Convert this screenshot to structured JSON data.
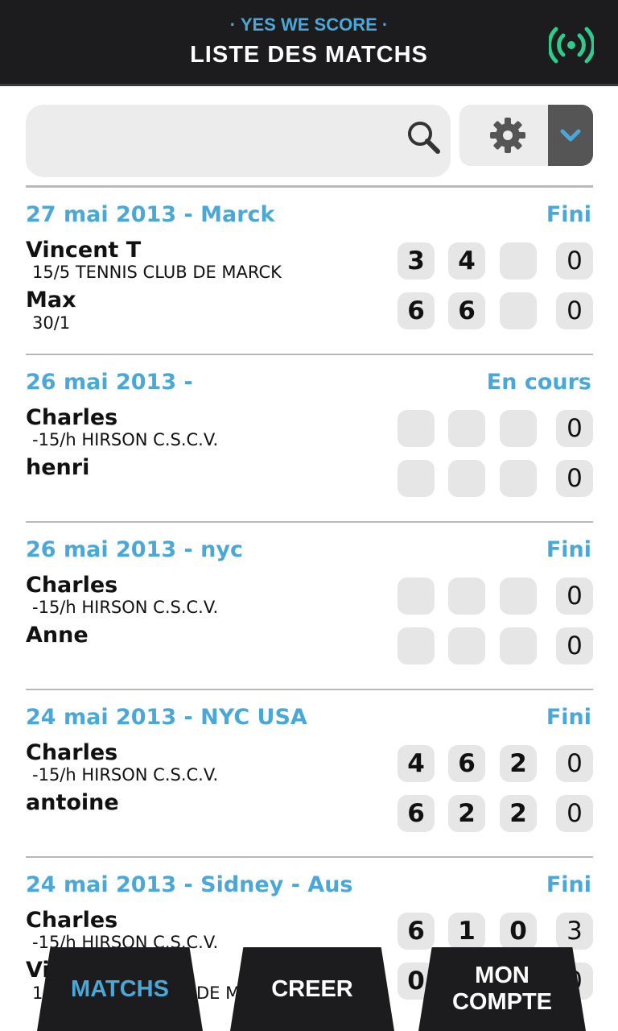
{
  "header": {
    "brand": "· YES WE SCORE ·",
    "title": "LISTE DES MATCHS"
  },
  "search": {
    "placeholder": ""
  },
  "colors": {
    "accent": "#4aa8d8",
    "dark": "#1c1c1e",
    "signal": "#2ecc8a"
  },
  "matches": [
    {
      "head": "27 mai 2013 - Marck",
      "status": "Fini",
      "p1": {
        "name": "Vincent T",
        "sub": "15/5 TENNIS CLUB DE MARCK",
        "s1": "3",
        "s2": "4",
        "s3": "",
        "pts": "0"
      },
      "p2": {
        "name": "Max",
        "sub": "30/1",
        "s1": "6",
        "s2": "6",
        "s3": "",
        "pts": "0"
      }
    },
    {
      "head": "26 mai 2013 -",
      "status": "En cours",
      "p1": {
        "name": "Charles",
        "sub": "-15/h HIRSON C.S.C.V.",
        "s1": "",
        "s2": "",
        "s3": "",
        "pts": "0"
      },
      "p2": {
        "name": "henri",
        "sub": "",
        "s1": "",
        "s2": "",
        "s3": "",
        "pts": "0"
      }
    },
    {
      "head": "26 mai 2013 - nyc",
      "status": "Fini",
      "p1": {
        "name": "Charles",
        "sub": "-15/h HIRSON C.S.C.V.",
        "s1": "",
        "s2": "",
        "s3": "",
        "pts": "0"
      },
      "p2": {
        "name": "Anne",
        "sub": "",
        "s1": "",
        "s2": "",
        "s3": "",
        "pts": "0"
      }
    },
    {
      "head": "24 mai 2013 - NYC USA",
      "status": "Fini",
      "p1": {
        "name": "Charles",
        "sub": "-15/h HIRSON C.S.C.V.",
        "s1": "4",
        "s2": "6",
        "s3": "2",
        "pts": "0"
      },
      "p2": {
        "name": "antoine",
        "sub": "",
        "s1": "6",
        "s2": "2",
        "s3": "2",
        "pts": "0"
      }
    },
    {
      "head": "24 mai 2013 - Sidney - Aus",
      "status": "Fini",
      "p1": {
        "name": "Charles",
        "sub": "-15/h HIRSON C.S.C.V.",
        "s1": "6",
        "s2": "1",
        "s3": "0",
        "pts": "3"
      },
      "p2": {
        "name": "Vi",
        "sub": "1",
        "sub_tail": "DE M",
        "s1": "0",
        "s2": "",
        "s3": "",
        "pts": "0"
      }
    }
  ],
  "nav": {
    "matchs": "MATCHS",
    "creer": "CREER",
    "compte_line1": "MON",
    "compte_line2": "COMPTE"
  }
}
